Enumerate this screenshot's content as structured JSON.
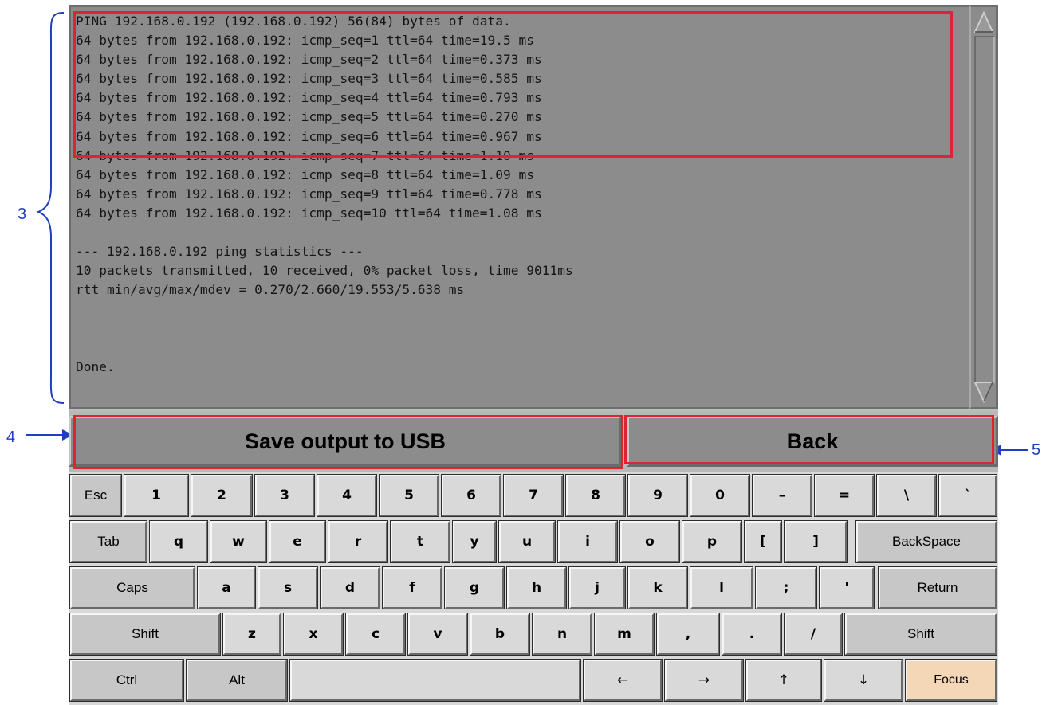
{
  "terminal": {
    "lines": [
      "PING 192.168.0.192 (192.168.0.192) 56(84) bytes of data.",
      "64 bytes from 192.168.0.192: icmp_seq=1 ttl=64 time=19.5 ms",
      "64 bytes from 192.168.0.192: icmp_seq=2 ttl=64 time=0.373 ms",
      "64 bytes from 192.168.0.192: icmp_seq=3 ttl=64 time=0.585 ms",
      "64 bytes from 192.168.0.192: icmp_seq=4 ttl=64 time=0.793 ms",
      "64 bytes from 192.168.0.192: icmp_seq=5 ttl=64 time=0.270 ms",
      "64 bytes from 192.168.0.192: icmp_seq=6 ttl=64 time=0.967 ms",
      "64 bytes from 192.168.0.192: icmp_seq=7 ttl=64 time=1.10 ms",
      "64 bytes from 192.168.0.192: icmp_seq=8 ttl=64 time=1.09 ms",
      "64 bytes from 192.168.0.192: icmp_seq=9 ttl=64 time=0.778 ms",
      "64 bytes from 192.168.0.192: icmp_seq=10 ttl=64 time=1.08 ms",
      "",
      "--- 192.168.0.192 ping statistics ---",
      "10 packets transmitted, 10 received, 0% packet loss, time 9011ms",
      "rtt min/avg/max/mdev = 0.270/2.660/19.553/5.638 ms",
      "",
      "",
      "",
      "Done."
    ]
  },
  "buttons": {
    "save_label": "Save output to USB",
    "back_label": "Back"
  },
  "callouts": {
    "c3": "3",
    "c4": "4",
    "c5": "5"
  },
  "keyboard": {
    "row1": [
      "Esc",
      "1",
      "2",
      "3",
      "4",
      "5",
      "6",
      "7",
      "8",
      "9",
      "0",
      "–",
      "=",
      "\\",
      "`"
    ],
    "row2": [
      "Tab",
      "q",
      "w",
      "e",
      "r",
      "t",
      "y",
      "u",
      "i",
      "o",
      "p",
      "[",
      "]",
      "BackSpace"
    ],
    "row3": [
      "Caps",
      "a",
      "s",
      "d",
      "f",
      "g",
      "h",
      "j",
      "k",
      "l",
      ";",
      "'",
      "Return"
    ],
    "row4": [
      "Shift",
      "z",
      "x",
      "c",
      "v",
      "b",
      "n",
      "m",
      ",",
      ".",
      "/",
      "Shift"
    ],
    "row5": [
      "Ctrl",
      "Alt",
      "",
      "←",
      "→",
      "↑",
      "↓",
      "Focus"
    ]
  },
  "icons": {
    "scroll_up": "scroll-up-arrow-icon",
    "scroll_down": "scroll-down-arrow-icon"
  },
  "colors": {
    "terminal_bg": "#8c8c8c",
    "annotation": "#e0242f",
    "callout": "#1f3fbf",
    "focus_key": "#f3d7b7"
  }
}
